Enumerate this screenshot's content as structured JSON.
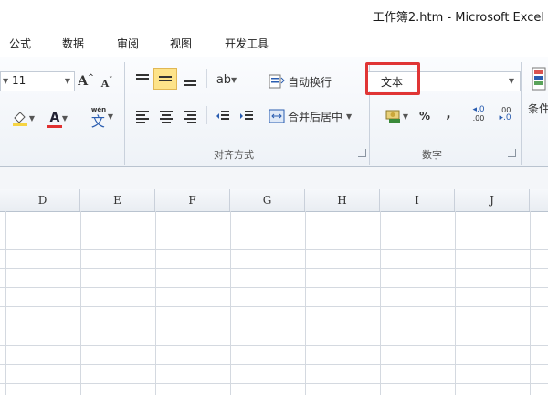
{
  "window": {
    "title": "工作簿2.htm  -  Microsoft Excel"
  },
  "tabs": [
    "公式",
    "数据",
    "审阅",
    "视图",
    "开发工具"
  ],
  "font": {
    "size_value": "11",
    "grow_label": "A",
    "shrink_label": "A",
    "font_color_label": "A",
    "phonetic_label": "wén"
  },
  "alignment": {
    "wrap_text_label": "自动换行",
    "merge_center_label": "合并后居中",
    "group_label": "对齐方式"
  },
  "number": {
    "format_value": "文本",
    "percent_label": "%",
    "comma_label": ",",
    "increase_decimal_label": ".00",
    "decrease_decimal_label": ".00",
    "group_label": "数字"
  },
  "styles": {
    "conditional_label": "条件"
  },
  "columns": [
    "D",
    "E",
    "F",
    "G",
    "H",
    "I",
    "J"
  ],
  "colors": {
    "highlight": "#e03535",
    "active_button": "#fde38a",
    "font_color_bar": "#e03030"
  }
}
